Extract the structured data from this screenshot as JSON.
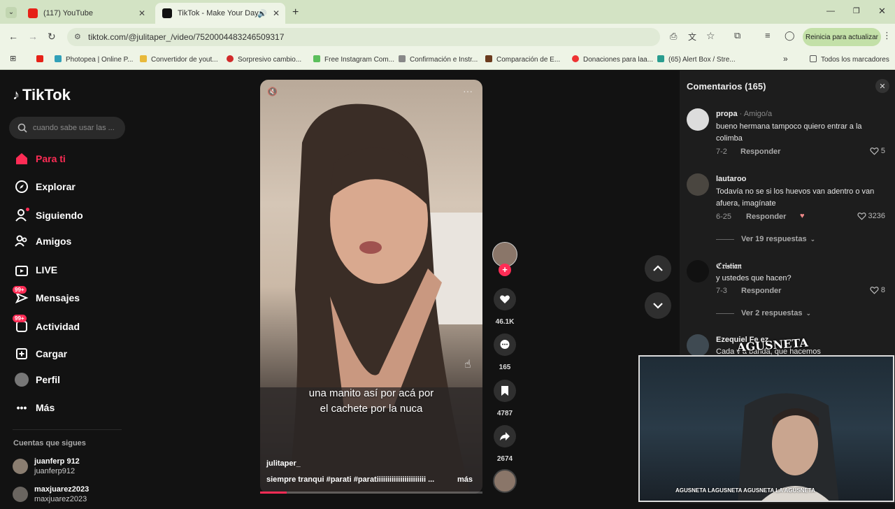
{
  "browser": {
    "tabs": [
      {
        "title": "(117) YouTube",
        "active": false
      },
      {
        "title": "TikTok - Make Your Day",
        "active": true
      }
    ],
    "url": "tiktok.com/@julitaper_/video/7520004483246509317",
    "update_button": "Reinicia para actualizar",
    "bookmarks": [
      "Photopea | Online P...",
      "Convertidor de yout...",
      "Sorpresivo cambio...",
      "Free Instagram Com...",
      "Confirmación e Instr...",
      "Comparación de E...",
      "Donaciones para laa...",
      "(65) Alert Box / Stre..."
    ],
    "all_bookmarks": "Todos los marcadores"
  },
  "tiktok": {
    "logo": "TikTok",
    "search_placeholder": "cuando sabe usar las ...",
    "nav": {
      "for_you": "Para ti",
      "explore": "Explorar",
      "following": "Siguiendo",
      "friends": "Amigos",
      "live": "LIVE",
      "messages": "Mensajes",
      "activity": "Actividad",
      "upload": "Cargar",
      "profile": "Perfil",
      "more": "Más"
    },
    "badge": "99+",
    "following_title": "Cuentas que sigues",
    "following_accounts": [
      {
        "name": "juanferp 912",
        "handle": "juanferp912"
      },
      {
        "name": "maxjuarez2023",
        "handle": "maxjuarez2023"
      }
    ]
  },
  "video": {
    "subtitle_line1": "una manito así por acá por",
    "subtitle_line2": "el cachete por la nuca",
    "author": "julitaper_",
    "caption": "siempre tranqui #parati  #paratiiiiiiiiiiiiiiiiiiiiiii ...",
    "more": "más",
    "likes": "46.1K",
    "comments": "165",
    "saves": "4787",
    "shares": "2674"
  },
  "comments_panel": {
    "title": "Comentarios (165)",
    "reply_label": "Responder",
    "items": [
      {
        "user": "propa",
        "relation": " · Amigo/a",
        "text": "bueno hermana tampoco quiero entrar a la colimba",
        "date": "7-2",
        "likes": "5"
      },
      {
        "user": "lautaroo",
        "text": "Todavía no se si los huevos van adentro o van afuera, imagínate",
        "date": "6-25",
        "likes": "3236",
        "replies": "Ver 19 respuestas"
      },
      {
        "user": "ℭ𝔯𝔦𝔰𝔱𝔦𝔞𝔫",
        "text": "y ustedes que hacen?",
        "date": "7-3",
        "likes": "8",
        "replies": "Ver 2 respuestas"
      },
      {
        "user": "Ezequiel Fe      ez",
        "text": "Cada v        a banda, que hacemos"
      }
    ]
  },
  "stream_overlay": {
    "logo": "AGUSNETA",
    "socials": "AGUSNETA   LAGUSNETA   AGUSNETA   LA AGUSNETA"
  }
}
